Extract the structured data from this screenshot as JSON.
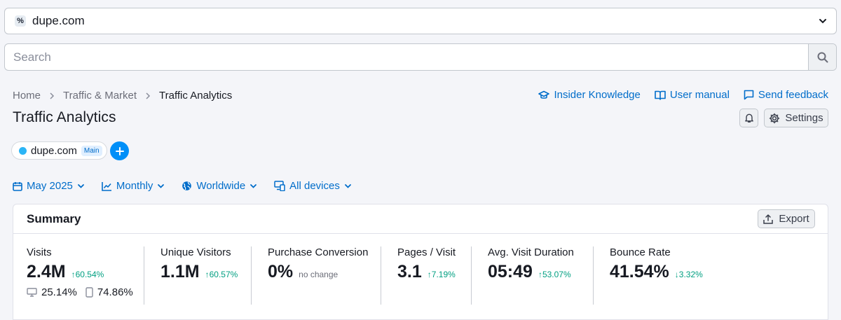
{
  "domain_select": {
    "favicon_glyph": "%",
    "value": "dupe.com",
    "icon": "chevron-down-icon"
  },
  "search": {
    "placeholder": "Search",
    "value": "",
    "icon": "search-icon"
  },
  "breadcrumb": {
    "items": [
      "Home",
      "Traffic & Market",
      "Traffic Analytics"
    ]
  },
  "top_links": {
    "insider": "Insider Knowledge",
    "manual": "User manual",
    "feedback": "Send feedback"
  },
  "page_title": "Traffic Analytics",
  "settings_label": "Settings",
  "domain_chip": {
    "name": "dupe.com",
    "badge": "Main",
    "dot_color": "#2bb5f6"
  },
  "filters": {
    "date": "May 2025",
    "granularity": "Monthly",
    "region": "Worldwide",
    "devices": "All devices"
  },
  "summary": {
    "title": "Summary",
    "export_label": "Export",
    "metrics": {
      "visits": {
        "label": "Visits",
        "value": "2.4M",
        "delta": "↑60.54%",
        "desktop": "25.14%",
        "mobile": "74.86%"
      },
      "unique": {
        "label": "Unique Visitors",
        "value": "1.1M",
        "delta": "↑60.57%"
      },
      "purchase": {
        "label": "Purchase Conversion",
        "value": "0%",
        "delta": "no change"
      },
      "pages": {
        "label": "Pages / Visit",
        "value": "3.1",
        "delta": "↑7.19%"
      },
      "duration": {
        "label": "Avg. Visit Duration",
        "value": "05:49",
        "delta": "↑53.07%"
      },
      "bounce": {
        "label": "Bounce Rate",
        "value": "41.54%",
        "delta": "↓3.32%"
      }
    }
  },
  "colors": {
    "link": "#006dca",
    "positive": "#009f81",
    "accent_button": "#008ff8"
  }
}
